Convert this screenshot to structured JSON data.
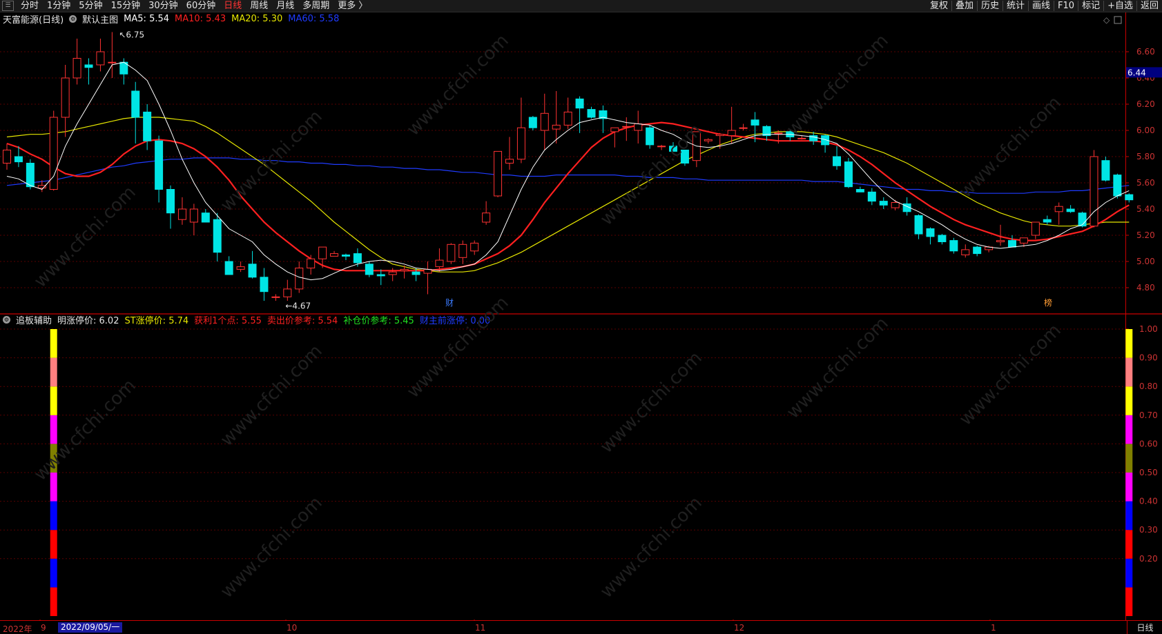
{
  "toolbar": {
    "left_items": [
      "分时",
      "1分钟",
      "5分钟",
      "15分钟",
      "30分钟",
      "60分钟",
      "日线",
      "周线",
      "月线",
      "多周期",
      "更多 〉"
    ],
    "active_item": "日线",
    "right_items": [
      "复权",
      "叠加",
      "历史",
      "统计",
      "画线",
      "F10",
      "标记",
      "+自选",
      "返回"
    ]
  },
  "main_info": {
    "stock": "天富能源(日线)",
    "template": "默认主图",
    "ma5": "MA5: 5.54",
    "ma10": "MA10: 5.43",
    "ma20": "MA20: 5.30",
    "ma60": "MA60: 5.58",
    "colors": {
      "ma5": "#ffffff",
      "ma10": "#ff2020",
      "ma20": "#e6e600",
      "ma60": "#1f3bff"
    }
  },
  "sub_info": {
    "name": "追板辅助",
    "ming": "明涨停价: 6.02",
    "st": "ST涨停价: 5.74",
    "huoli": "获利1个点: 5.55",
    "maichu": "卖出价参考: 5.54",
    "bucang": "补仓价参考: 5.45",
    "caizhu": "财主前涨停: 0.00"
  },
  "main_axis": {
    "labels": [
      "6.60",
      "6.40",
      "6.20",
      "6.00",
      "5.80",
      "5.60",
      "5.40",
      "5.20",
      "5.00",
      "4.80"
    ],
    "current": "6.44"
  },
  "sub_axis": {
    "labels": [
      "1.00",
      "0.90",
      "0.80",
      "0.70",
      "0.60",
      "0.50",
      "0.40",
      "0.30",
      "0.20"
    ]
  },
  "annotations": {
    "high": "6.75",
    "low": "4.67",
    "cai": "财",
    "bang": "榜"
  },
  "bottom": {
    "year": "2022年",
    "months": [
      "9",
      "10",
      "11",
      "12",
      "1"
    ],
    "cursor_date": "2022/09/05/一",
    "period": "日线"
  },
  "chart_data": {
    "type": "candlestick",
    "price_ylim": [
      4.6,
      6.8
    ],
    "indicator_ylim": [
      0,
      1.0
    ],
    "up_color": "#ff3232",
    "down_color": "#00e5e5",
    "ohlc": [
      [
        5.75,
        5.9,
        5.7,
        5.85
      ],
      [
        5.8,
        5.88,
        5.72,
        5.76
      ],
      [
        5.75,
        5.78,
        5.55,
        5.57
      ],
      [
        5.56,
        5.62,
        5.53,
        5.58
      ],
      [
        5.55,
        6.15,
        5.54,
        6.1
      ],
      [
        6.1,
        6.5,
        5.95,
        6.4
      ],
      [
        6.4,
        6.7,
        6.35,
        6.55
      ],
      [
        6.5,
        6.55,
        6.35,
        6.48
      ],
      [
        6.5,
        6.7,
        6.45,
        6.6
      ],
      [
        6.52,
        6.75,
        6.4,
        6.52
      ],
      [
        6.52,
        6.55,
        6.35,
        6.43
      ],
      [
        6.3,
        6.37,
        5.9,
        6.1
      ],
      [
        6.14,
        6.2,
        5.85,
        5.92
      ],
      [
        5.92,
        5.96,
        5.45,
        5.55
      ],
      [
        5.55,
        5.58,
        5.25,
        5.37
      ],
      [
        5.32,
        5.49,
        5.28,
        5.4
      ],
      [
        5.3,
        5.44,
        5.2,
        5.4
      ],
      [
        5.37,
        5.4,
        5.31,
        5.3
      ],
      [
        5.32,
        5.37,
        5.0,
        5.07
      ],
      [
        5.0,
        5.04,
        4.9,
        4.9
      ],
      [
        4.94,
        5.0,
        4.92,
        4.96
      ],
      [
        4.98,
        5.08,
        4.87,
        4.88
      ],
      [
        4.88,
        4.95,
        4.7,
        4.77
      ],
      [
        4.73,
        4.75,
        4.7,
        4.73
      ],
      [
        4.73,
        4.86,
        4.7,
        4.79
      ],
      [
        4.79,
        5.0,
        4.76,
        4.95
      ],
      [
        4.95,
        5.05,
        4.9,
        5.02
      ],
      [
        5.02,
        5.1,
        4.95,
        5.11
      ],
      [
        5.04,
        5.08,
        5.04,
        5.06
      ],
      [
        5.05,
        5.06,
        5.01,
        5.04
      ],
      [
        5.06,
        5.1,
        4.96,
        4.99
      ],
      [
        4.98,
        5.0,
        4.88,
        4.9
      ],
      [
        4.9,
        4.94,
        4.82,
        4.89
      ],
      [
        4.9,
        4.95,
        4.85,
        4.92
      ],
      [
        4.93,
        4.97,
        4.87,
        4.94
      ],
      [
        4.92,
        4.95,
        4.85,
        4.9
      ],
      [
        4.91,
        5.0,
        4.75,
        4.94
      ],
      [
        4.96,
        5.1,
        4.92,
        5.01
      ],
      [
        5.0,
        5.14,
        4.98,
        5.13
      ],
      [
        5.03,
        5.16,
        4.98,
        5.13
      ],
      [
        5.08,
        5.16,
        5.05,
        5.14
      ],
      [
        5.3,
        5.46,
        5.28,
        5.37
      ],
      [
        5.5,
        5.84,
        5.49,
        5.84
      ],
      [
        5.75,
        5.95,
        5.7,
        5.78
      ],
      [
        5.78,
        6.25,
        5.75,
        6.02
      ],
      [
        6.1,
        6.11,
        6.0,
        6.02
      ],
      [
        6.0,
        6.28,
        5.85,
        6.13
      ],
      [
        6.01,
        6.3,
        5.9,
        6.04
      ],
      [
        6.04,
        6.25,
        6.01,
        6.14
      ],
      [
        6.24,
        6.26,
        5.98,
        6.17
      ],
      [
        6.16,
        6.18,
        6.09,
        6.1
      ],
      [
        6.15,
        6.19,
        5.98,
        6.09
      ],
      [
        5.99,
        6.02,
        5.87,
        6.02
      ],
      [
        6.03,
        6.1,
        5.92,
        6.03
      ],
      [
        6.0,
        6.15,
        5.9,
        6.05
      ],
      [
        6.02,
        6.04,
        5.86,
        5.89
      ],
      [
        5.88,
        5.89,
        5.85,
        5.88
      ],
      [
        5.88,
        5.91,
        5.84,
        5.84
      ],
      [
        5.85,
        5.85,
        5.73,
        5.75
      ],
      [
        5.77,
        5.99,
        5.72,
        5.99
      ],
      [
        5.92,
        5.94,
        5.9,
        5.93
      ],
      [
        5.96,
        5.98,
        5.86,
        5.97
      ],
      [
        5.96,
        6.18,
        5.9,
        6.0
      ],
      [
        6.02,
        6.05,
        6.0,
        6.02
      ],
      [
        6.08,
        6.14,
        5.91,
        6.04
      ],
      [
        6.03,
        6.04,
        5.92,
        5.96
      ],
      [
        5.98,
        6.0,
        5.9,
        5.98
      ],
      [
        5.99,
        6.01,
        5.92,
        5.95
      ],
      [
        5.94,
        5.96,
        5.93,
        5.94
      ],
      [
        5.96,
        5.99,
        5.89,
        5.92
      ],
      [
        5.96,
        5.97,
        5.83,
        5.89
      ],
      [
        5.8,
        5.88,
        5.7,
        5.73
      ],
      [
        5.76,
        5.79,
        5.56,
        5.57
      ],
      [
        5.55,
        5.57,
        5.54,
        5.53
      ],
      [
        5.53,
        5.56,
        5.43,
        5.46
      ],
      [
        5.46,
        5.49,
        5.4,
        5.43
      ],
      [
        5.41,
        5.47,
        5.39,
        5.45
      ],
      [
        5.44,
        5.49,
        5.35,
        5.38
      ],
      [
        5.35,
        5.36,
        5.17,
        5.21
      ],
      [
        5.25,
        5.26,
        5.13,
        5.19
      ],
      [
        5.2,
        5.21,
        5.13,
        5.15
      ],
      [
        5.16,
        5.18,
        5.06,
        5.08
      ],
      [
        5.05,
        5.13,
        5.03,
        5.09
      ],
      [
        5.11,
        5.12,
        5.04,
        5.06
      ],
      [
        5.09,
        5.12,
        5.07,
        5.11
      ],
      [
        5.15,
        5.28,
        5.12,
        5.16
      ],
      [
        5.16,
        5.2,
        5.12,
        5.11
      ],
      [
        5.14,
        5.18,
        5.11,
        5.18
      ],
      [
        5.2,
        5.3,
        5.17,
        5.3
      ],
      [
        5.32,
        5.35,
        5.28,
        5.3
      ],
      [
        5.38,
        5.45,
        5.28,
        5.42
      ],
      [
        5.4,
        5.43,
        5.37,
        5.38
      ],
      [
        5.37,
        5.38,
        5.26,
        5.27
      ],
      [
        5.27,
        5.85,
        5.26,
        5.8
      ],
      [
        5.77,
        5.8,
        5.61,
        5.62
      ],
      [
        5.66,
        5.67,
        5.48,
        5.5
      ],
      [
        5.51,
        5.52,
        5.45,
        5.47
      ]
    ],
    "ma5": [
      5.65,
      5.63,
      5.58,
      5.55,
      5.65,
      5.88,
      6.05,
      6.2,
      6.35,
      6.5,
      6.52,
      6.46,
      6.38,
      6.2,
      6.0,
      5.78,
      5.6,
      5.45,
      5.35,
      5.25,
      5.2,
      5.15,
      5.05,
      4.98,
      4.92,
      4.88,
      4.86,
      4.87,
      4.91,
      4.95,
      4.98,
      5.0,
      5.01,
      5.0,
      4.98,
      4.95,
      4.94,
      4.93,
      4.94,
      4.96,
      4.98,
      5.05,
      5.15,
      5.35,
      5.55,
      5.72,
      5.85,
      5.93,
      6.0,
      6.06,
      6.08,
      6.1,
      6.08,
      6.06,
      6.05,
      6.04,
      6.0,
      5.97,
      5.92,
      5.88,
      5.87,
      5.88,
      5.9,
      5.93,
      5.96,
      5.97,
      5.97,
      5.97,
      5.96,
      5.95,
      5.93,
      5.9,
      5.82,
      5.72,
      5.62,
      5.53,
      5.46,
      5.42,
      5.38,
      5.33,
      5.28,
      5.22,
      5.17,
      5.13,
      5.11,
      5.1,
      5.11,
      5.12,
      5.13,
      5.16,
      5.2,
      5.25,
      5.28,
      5.38,
      5.45,
      5.5,
      5.54
    ],
    "ma10": [
      5.9,
      5.87,
      5.82,
      5.78,
      5.72,
      5.67,
      5.65,
      5.65,
      5.68,
      5.74,
      5.82,
      5.88,
      5.92,
      5.93,
      5.92,
      5.9,
      5.86,
      5.8,
      5.72,
      5.62,
      5.5,
      5.4,
      5.3,
      5.22,
      5.15,
      5.08,
      5.02,
      4.97,
      4.94,
      4.93,
      4.93,
      4.93,
      4.93,
      4.93,
      4.93,
      4.93,
      4.93,
      4.94,
      4.95,
      4.96,
      4.98,
      5.02,
      5.06,
      5.12,
      5.2,
      5.32,
      5.45,
      5.56,
      5.67,
      5.77,
      5.87,
      5.94,
      5.99,
      6.02,
      6.04,
      6.05,
      6.06,
      6.05,
      6.03,
      6.01,
      5.99,
      5.97,
      5.96,
      5.95,
      5.94,
      5.93,
      5.92,
      5.92,
      5.92,
      5.92,
      5.91,
      5.89,
      5.85,
      5.8,
      5.74,
      5.67,
      5.6,
      5.54,
      5.48,
      5.42,
      5.37,
      5.32,
      5.28,
      5.25,
      5.22,
      5.19,
      5.17,
      5.16,
      5.16,
      5.17,
      5.19,
      5.21,
      5.23,
      5.27,
      5.32,
      5.38,
      5.43
    ],
    "ma20": [
      5.95,
      5.96,
      5.97,
      5.97,
      5.98,
      5.99,
      6.01,
      6.03,
      6.05,
      6.07,
      6.09,
      6.1,
      6.1,
      6.1,
      6.09,
      6.08,
      6.07,
      6.03,
      5.98,
      5.92,
      5.86,
      5.8,
      5.74,
      5.67,
      5.6,
      5.53,
      5.46,
      5.38,
      5.3,
      5.23,
      5.16,
      5.09,
      5.03,
      4.98,
      4.96,
      4.94,
      4.93,
      4.92,
      4.92,
      4.92,
      4.93,
      4.96,
      4.99,
      5.03,
      5.07,
      5.12,
      5.17,
      5.22,
      5.27,
      5.32,
      5.37,
      5.42,
      5.47,
      5.52,
      5.57,
      5.62,
      5.67,
      5.72,
      5.77,
      5.81,
      5.85,
      5.89,
      5.92,
      5.95,
      5.97,
      5.98,
      5.99,
      5.99,
      5.99,
      5.98,
      5.97,
      5.95,
      5.92,
      5.89,
      5.86,
      5.83,
      5.79,
      5.75,
      5.7,
      5.65,
      5.6,
      5.55,
      5.5,
      5.45,
      5.41,
      5.37,
      5.34,
      5.31,
      5.29,
      5.28,
      5.27,
      5.27,
      5.28,
      5.29,
      5.3,
      5.3,
      5.3
    ],
    "ma60": [
      5.58,
      5.59,
      5.6,
      5.61,
      5.62,
      5.64,
      5.66,
      5.68,
      5.7,
      5.72,
      5.73,
      5.75,
      5.76,
      5.77,
      5.78,
      5.78,
      5.79,
      5.79,
      5.79,
      5.79,
      5.78,
      5.78,
      5.77,
      5.77,
      5.76,
      5.76,
      5.75,
      5.75,
      5.74,
      5.74,
      5.73,
      5.73,
      5.72,
      5.72,
      5.71,
      5.71,
      5.7,
      5.7,
      5.69,
      5.68,
      5.68,
      5.67,
      5.66,
      5.66,
      5.65,
      5.65,
      5.65,
      5.66,
      5.66,
      5.66,
      5.66,
      5.66,
      5.66,
      5.65,
      5.65,
      5.64,
      5.64,
      5.64,
      5.63,
      5.63,
      5.62,
      5.62,
      5.62,
      5.62,
      5.62,
      5.62,
      5.62,
      5.62,
      5.62,
      5.61,
      5.61,
      5.61,
      5.6,
      5.59,
      5.58,
      5.57,
      5.56,
      5.55,
      5.55,
      5.54,
      5.54,
      5.53,
      5.53,
      5.52,
      5.52,
      5.52,
      5.52,
      5.52,
      5.53,
      5.53,
      5.53,
      5.54,
      5.54,
      5.55,
      5.56,
      5.57,
      5.58
    ],
    "indicator_stacks": [
      {
        "x_index": 4,
        "colors": [
          "#ff0000",
          "#0000ff",
          "#ff0000",
          "#0000ff",
          "#ff00ff",
          "#808000",
          "#ff00ff",
          "#ffff00",
          "#ff8080",
          "#ffff00"
        ]
      },
      {
        "x_index": 96,
        "colors": [
          "#ff0000",
          "#0000ff",
          "#ff0000",
          "#0000ff",
          "#ff00ff",
          "#808000",
          "#ff00ff",
          "#ffff00",
          "#ff8080",
          "#ffff00"
        ]
      }
    ]
  }
}
